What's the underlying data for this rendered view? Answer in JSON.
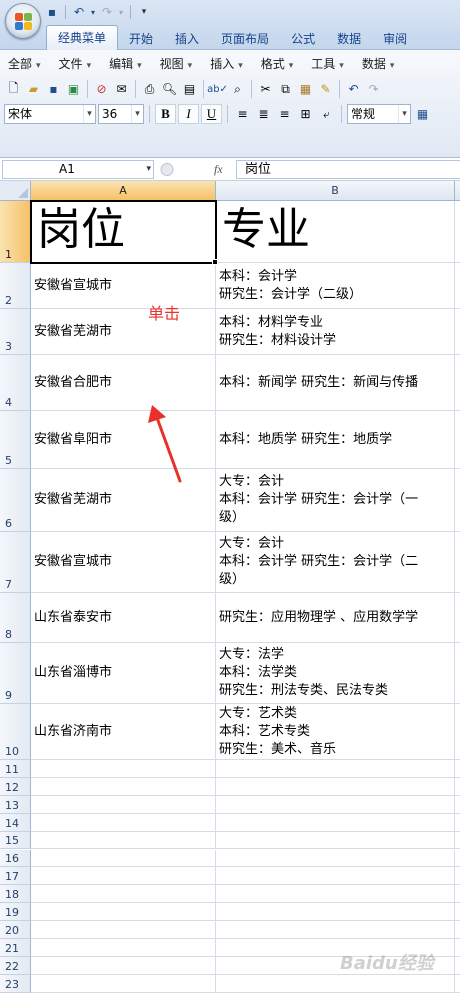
{
  "quick_access": {
    "icons": [
      "save-icon",
      "undo-icon",
      "redo-icon",
      "customize-icon"
    ]
  },
  "tabs": [
    {
      "label": "经典菜单",
      "active": true
    },
    {
      "label": "开始"
    },
    {
      "label": "插入"
    },
    {
      "label": "页面布局"
    },
    {
      "label": "公式"
    },
    {
      "label": "数据"
    },
    {
      "label": "审阅"
    }
  ],
  "menus": [
    "全部",
    "文件",
    "编辑",
    "视图",
    "插入",
    "格式",
    "工具",
    "数据"
  ],
  "format_toolbar": {
    "font": "宋体",
    "size": "36",
    "bold": "B",
    "italic": "I",
    "underline": "U",
    "number_format": "常规"
  },
  "formula_bar": {
    "cell_ref": "A1",
    "fx": "fx",
    "content": "岗位"
  },
  "columns": [
    {
      "label": "A",
      "selected": true
    },
    {
      "label": "B"
    },
    {
      "label": ""
    }
  ],
  "rows": [
    {
      "n": "1",
      "a": "岗位",
      "b": "专业",
      "selected": true
    },
    {
      "n": "2",
      "a": "安徽省宣城市",
      "b": "本科：会计学\n研究生：会计学（二级）"
    },
    {
      "n": "3",
      "a": "安徽省芜湖市",
      "b": "本科：材料学专业\n  研究生：材料设计学"
    },
    {
      "n": "4",
      "a": "安徽省合肥市",
      "b": "本科：新闻学 研究生：新闻与传播"
    },
    {
      "n": "5",
      "a": "安徽省阜阳市",
      "b": "本科：地质学 研究生：地质学"
    },
    {
      "n": "6",
      "a": "安徽省芜湖市",
      "b": "大专：会计\n本科：会计学 研究生：会计学（一\n级）"
    },
    {
      "n": "7",
      "a": "安徽省宣城市",
      "b": "大专：会计\n本科：会计学 研究生：会计学（二\n级）"
    },
    {
      "n": "8",
      "a": "山东省泰安市",
      "b": "研究生：应用物理学 、应用数学学"
    },
    {
      "n": "9",
      "a": "山东省淄博市",
      "b": "大专：法学\n本科：法学类\n研究生：刑法专类、民法专类"
    },
    {
      "n": "10",
      "a": "山东省济南市",
      "b": "大专：艺术类\n本科：艺术专类\n研究生：美术、音乐"
    },
    {
      "n": "11"
    },
    {
      "n": "12"
    },
    {
      "n": "13"
    },
    {
      "n": "14"
    },
    {
      "n": "15"
    },
    {
      "n": "16"
    },
    {
      "n": "17"
    },
    {
      "n": "18"
    },
    {
      "n": "19"
    },
    {
      "n": "20"
    },
    {
      "n": "21"
    },
    {
      "n": "22"
    },
    {
      "n": "23"
    }
  ],
  "annotation": {
    "text": "单击",
    "color": "#e8312a"
  },
  "watermark": "Baidu经验",
  "colors": {
    "selection_header": "#f6c167",
    "ribbon": "#dfe8f4",
    "accent": "#15428b"
  }
}
